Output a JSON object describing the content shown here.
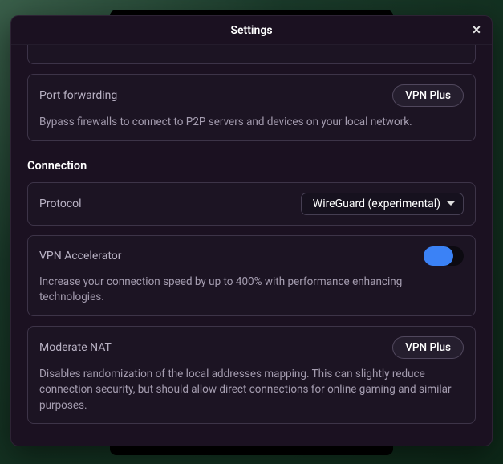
{
  "modal": {
    "title": "Settings",
    "close_icon": "✕"
  },
  "port_forwarding": {
    "title": "Port forwarding",
    "badge": "VPN Plus",
    "desc": "Bypass firewalls to connect to P2P servers and devices on your local network."
  },
  "connection": {
    "section_title": "Connection",
    "protocol": {
      "title": "Protocol",
      "value": "WireGuard (experimental)"
    },
    "accelerator": {
      "title": "VPN Accelerator",
      "enabled": true,
      "desc": "Increase your connection speed by up to 400% with performance enhancing technologies."
    },
    "moderate_nat": {
      "title": "Moderate NAT",
      "badge": "VPN Plus",
      "desc": "Disables randomization of the local addresses mapping. This can slightly reduce connection security, but should allow direct connections for online gaming and similar purposes."
    }
  }
}
